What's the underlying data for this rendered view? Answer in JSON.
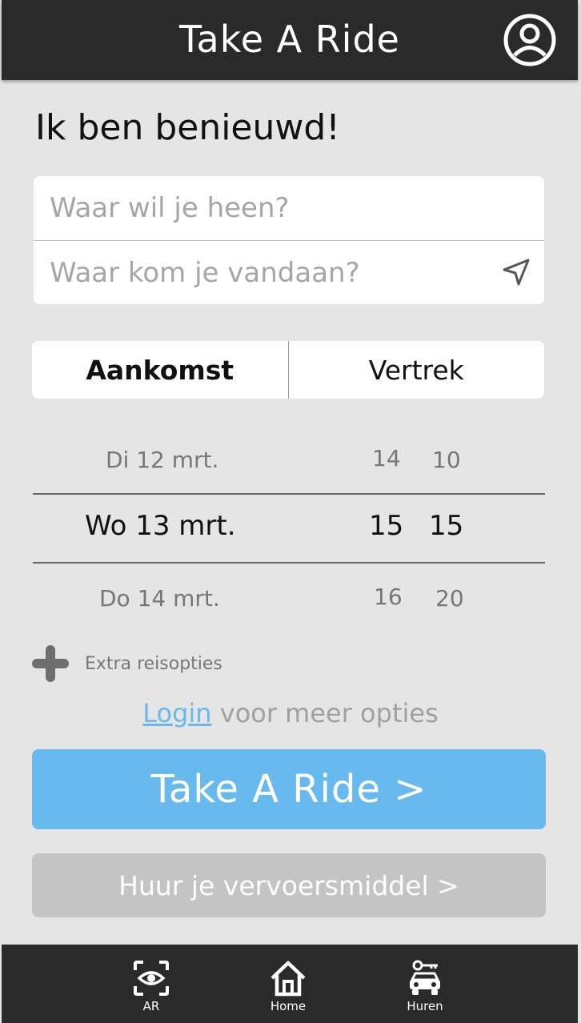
{
  "header": {
    "title": "Take A Ride",
    "profile_icon": "user-circle-icon"
  },
  "heading": "Ik ben benieuwd!",
  "inputs": {
    "destination_placeholder": "Waar wil je heen?",
    "origin_placeholder": "Waar kom je vandaan?",
    "location_icon": "navigation-arrow-icon"
  },
  "toggle": {
    "arrival": "Aankomst",
    "departure": "Vertrek",
    "active": "arrival"
  },
  "picker": {
    "rows": [
      {
        "date": "Di 12 mrt.",
        "hour": "14",
        "minute": "10"
      },
      {
        "date": "Wo 13 mrt.",
        "hour": "15",
        "minute": "15"
      },
      {
        "date": "Do 14 mrt.",
        "hour": "16",
        "minute": "20"
      }
    ],
    "selected_index": 1
  },
  "extra_options": {
    "label": "Extra reisopties",
    "icon": "plus-icon"
  },
  "login": {
    "link": "Login",
    "text": " voor meer opties"
  },
  "buttons": {
    "primary": "Take A Ride >",
    "secondary": "Huur je vervoersmiddel >"
  },
  "nav": [
    {
      "label": "AR",
      "icon": "ar-eye-scan-icon"
    },
    {
      "label": "Home",
      "icon": "home-icon"
    },
    {
      "label": "Huren",
      "icon": "car-key-icon"
    }
  ],
  "colors": {
    "bar": "#2a2a2a",
    "background": "#e5e5e5",
    "primary": "#67b9ee",
    "secondary": "#c4c4c4",
    "link": "#6bb8ec"
  }
}
